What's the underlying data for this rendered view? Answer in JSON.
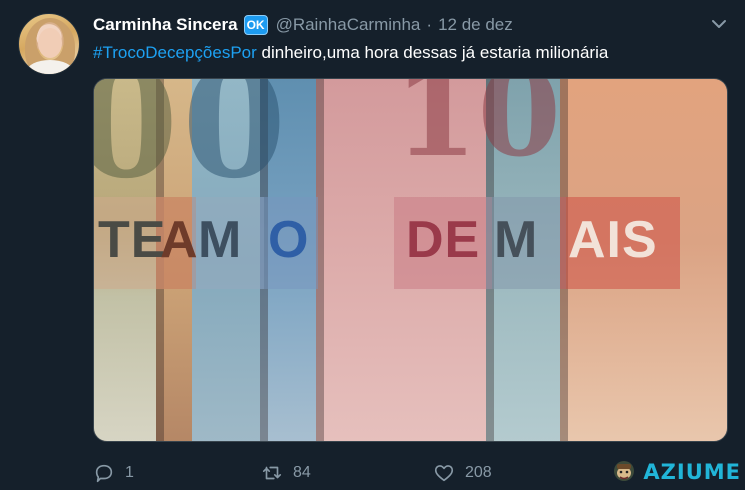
{
  "tweet": {
    "display_name": "Carminha Sincera",
    "verified_badge": "OK",
    "handle": "@RainhaCarminha",
    "separator": "·",
    "date": "12 de dez",
    "hashtag": "#TrocoDecepçõesPor",
    "body": " dinheiro,uma hora dessas já estaria milionária",
    "media": {
      "banknote_words": [
        "TE",
        "A",
        "M",
        "O",
        "DE",
        "M",
        "AIS"
      ],
      "banknote_numbers": [
        "0",
        "0",
        "10"
      ]
    },
    "actions": {
      "reply_count": "1",
      "retweet_count": "84",
      "like_count": "208"
    }
  },
  "watermark": {
    "text": "AZIUME"
  },
  "colors": {
    "background": "#15202b",
    "text": "#ffffff",
    "muted": "#8899a6",
    "link": "#1da1f2",
    "watermark": "#21b5d8"
  },
  "icons": [
    "chevron-down-icon",
    "reply-icon",
    "retweet-icon",
    "like-icon",
    "watermark-logo-icon"
  ]
}
